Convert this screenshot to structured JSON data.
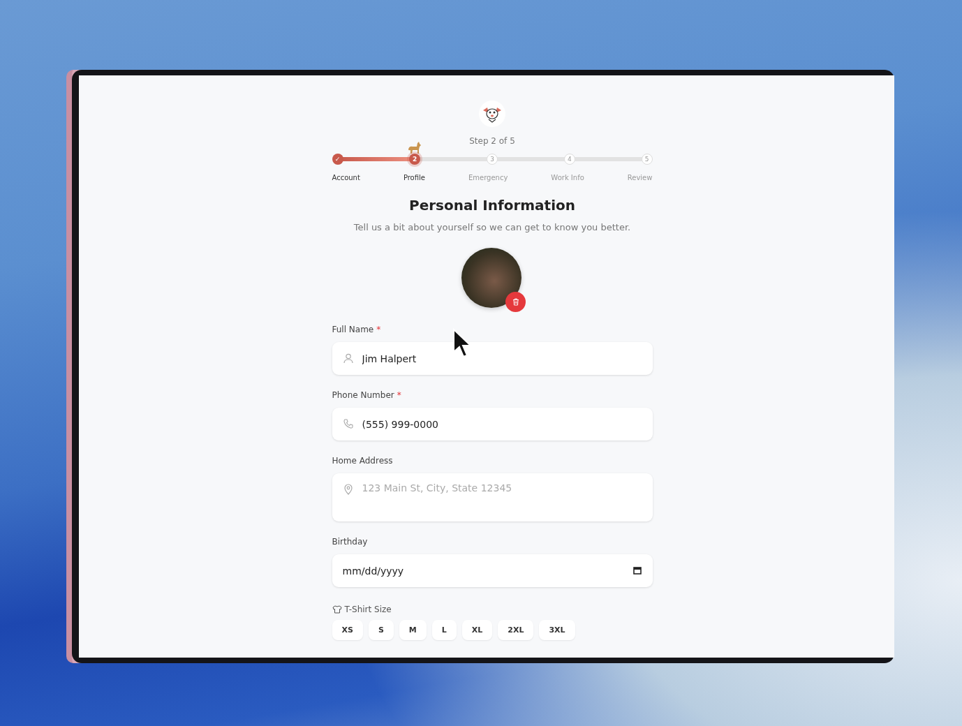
{
  "progress": {
    "caption": "Step 2 of 5",
    "level": 0.25,
    "steps": [
      {
        "label": "Account",
        "marker": "✓",
        "kind": "done"
      },
      {
        "label": "Profile",
        "marker": "2",
        "kind": "current"
      },
      {
        "label": "Emergency",
        "marker": "3",
        "kind": "upcoming"
      },
      {
        "label": "Work Info",
        "marker": "4",
        "kind": "upcoming"
      },
      {
        "label": "Review",
        "marker": "5",
        "kind": "upcoming"
      }
    ]
  },
  "heading": "Personal Information",
  "subheading": "Tell us a bit about yourself so we can get to know you better.",
  "fields": [
    {
      "label": "Full Name",
      "required_mark": "*",
      "kind": "name",
      "value": "Jim Halpert"
    },
    {
      "label": "Phone Number",
      "required_mark": "*",
      "kind": "phone",
      "value": "(555) 999-0000"
    },
    {
      "label": "Home Address",
      "kind": "address",
      "placeholder": "123 Main St, City, State 12345"
    },
    {
      "label": "Birthday",
      "kind": "date",
      "placeholder": "mm/dd/yyyy"
    }
  ],
  "tshirt": {
    "label": "T-Shirt Size",
    "sizes": [
      {
        "label": "XS",
        "selected": false
      },
      {
        "label": "S",
        "selected": false
      },
      {
        "label": "M",
        "selected": false
      },
      {
        "label": "L",
        "selected": false
      },
      {
        "label": "XL",
        "selected": false
      },
      {
        "label": "2XL",
        "selected": false
      },
      {
        "label": "3XL",
        "selected": false
      }
    ]
  }
}
